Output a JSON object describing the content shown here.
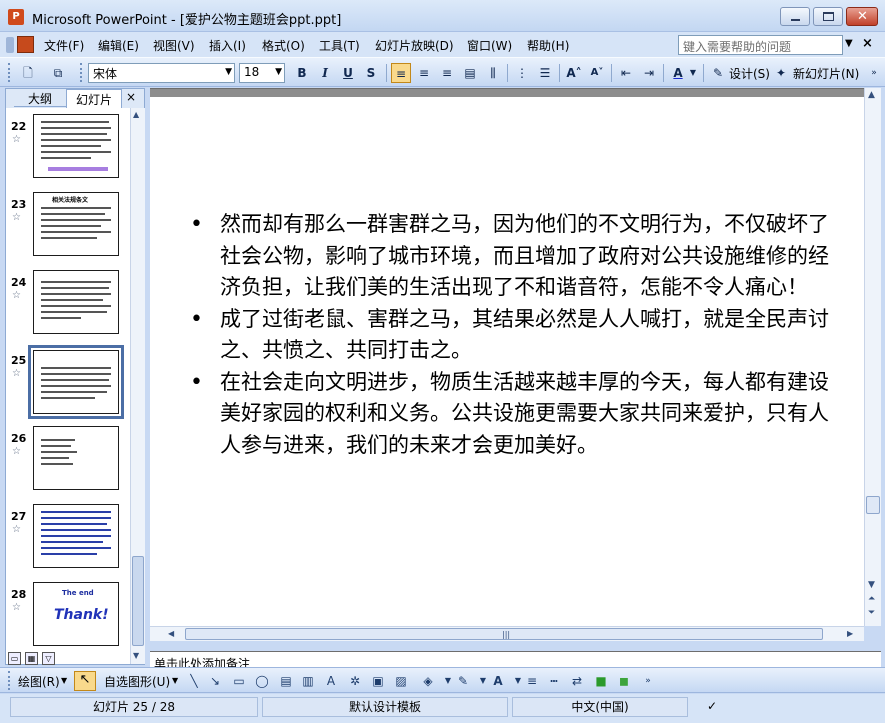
{
  "window": {
    "title": "Microsoft PowerPoint - [爱护公物主题班会ppt.ppt]"
  },
  "menu": {
    "items": [
      "文件(F)",
      "编辑(E)",
      "视图(V)",
      "插入(I)",
      "格式(O)",
      "工具(T)",
      "幻灯片放映(D)",
      "窗口(W)",
      "帮助(H)"
    ],
    "help_placeholder": "键入需要帮助的问题"
  },
  "toolbar": {
    "font": "宋体",
    "size": "18",
    "bold": "B",
    "italic": "I",
    "underline": "U",
    "shadow": "S",
    "design_label": "设计(S)",
    "new_slide_label": "新幻灯片(N)"
  },
  "left_panel": {
    "tab_outline": "大纲",
    "tab_slides": "幻灯片",
    "close": "×",
    "slides": [
      {
        "number": "22"
      },
      {
        "number": "23",
        "heading": "相关法规条文"
      },
      {
        "number": "24"
      },
      {
        "number": "25"
      },
      {
        "number": "26"
      },
      {
        "number": "27"
      },
      {
        "number": "28",
        "line1": "The end",
        "line2": "Thank!"
      }
    ]
  },
  "slide": {
    "bullets": [
      "然而却有那么一群害群之马，因为他们的不文明行为，不仅破坏了社会公物，影响了城市环境，而且增加了政府对公共设施维修的经济负担，让我们美的生活出现了不和谐音符，怎能不令人痛心！",
      " 成了过街老鼠、害群之马，其结果必然是人人喊打，就是全民声讨之、共愤之、共同打击之。",
      " 在社会走向文明进步，物质生活越来越丰厚的今天，每人都有建设美好家园的权利和义务。公共设施更需要大家共同来爱护，只有人人参与进来，我们的未来才会更加美好。"
    ]
  },
  "notes": {
    "placeholder": "单击此处添加备注"
  },
  "draw_toolbar": {
    "draw_label": "绘图(R)",
    "autoshape_label": "自选图形(U)"
  },
  "status": {
    "slide_position": "幻灯片 25 / 28",
    "template": "默认设计模板",
    "language": "中文(中国)"
  }
}
